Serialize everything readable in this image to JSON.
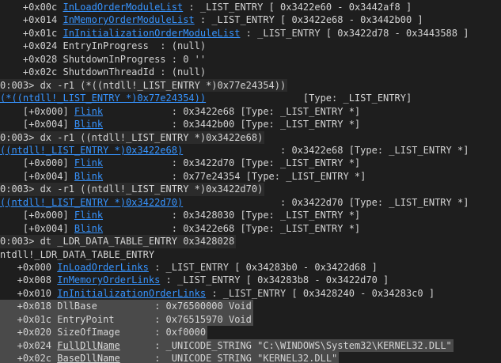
{
  "lines": [
    {
      "cls": "",
      "segs": [
        {
          "t": "    +0x00c "
        },
        {
          "l": "InLoadOrderModuleList"
        },
        {
          "t": " : _LIST_ENTRY [ 0x3422e60 - 0x3442af8 ]"
        }
      ]
    },
    {
      "cls": "",
      "segs": [
        {
          "t": "    +0x014 "
        },
        {
          "l": "InMemoryOrderModuleList"
        },
        {
          "t": " : _LIST_ENTRY [ 0x3422e68 - 0x3442b00 ]"
        }
      ]
    },
    {
      "cls": "",
      "segs": [
        {
          "t": "    +0x01c "
        },
        {
          "l": "InInitializationOrderModuleList"
        },
        {
          "t": " : _LIST_ENTRY [ 0x3422d78 - 0x3443588 ]"
        }
      ]
    },
    {
      "cls": "",
      "segs": [
        {
          "t": "    +0x024 EntryInProgress  : (null)"
        }
      ]
    },
    {
      "cls": "",
      "segs": [
        {
          "t": "    +0x028 ShutdownInProgress : 0 ''"
        }
      ]
    },
    {
      "cls": "",
      "segs": [
        {
          "t": "    +0x02c ShutdownThreadId : (null)"
        }
      ]
    },
    {
      "cls": "hl",
      "segs": [
        {
          "t": "0:003> dx -r1 (*((ntdll!_LIST_ENTRY *)0x77e24354))"
        }
      ]
    },
    {
      "cls": "",
      "segs": [
        {
          "l": "(*((ntdll!_LIST_ENTRY *)0x77e24354))"
        },
        {
          "t": "                 [Type: _LIST_ENTRY]"
        }
      ]
    },
    {
      "cls": "",
      "segs": [
        {
          "t": "    [+0x000] "
        },
        {
          "l": "Flink"
        },
        {
          "t": "            : 0x3422e68 [Type: _LIST_ENTRY *]"
        }
      ]
    },
    {
      "cls": "",
      "segs": [
        {
          "t": "    [+0x004] "
        },
        {
          "l": "Blink"
        },
        {
          "t": "            : 0x3442b00 [Type: _LIST_ENTRY *]"
        }
      ]
    },
    {
      "cls": "hl",
      "segs": [
        {
          "t": "0:003> dx -r1 ((ntdll!_LIST_ENTRY *)0x3422e68)"
        }
      ]
    },
    {
      "cls": "",
      "segs": [
        {
          "l": "((ntdll!_LIST_ENTRY *)0x3422e68)"
        },
        {
          "t": "                 : 0x3422e68 [Type: _LIST_ENTRY *]"
        }
      ]
    },
    {
      "cls": "",
      "segs": [
        {
          "t": "    [+0x000] "
        },
        {
          "l": "Flink"
        },
        {
          "t": "            : 0x3422d70 [Type: _LIST_ENTRY *]"
        }
      ]
    },
    {
      "cls": "",
      "segs": [
        {
          "t": "    [+0x004] "
        },
        {
          "l": "Blink"
        },
        {
          "t": "            : 0x77e24354 [Type: _LIST_ENTRY *]"
        }
      ]
    },
    {
      "cls": "hl",
      "segs": [
        {
          "t": "0:003> dx -r1 ((ntdll!_LIST_ENTRY *)0x3422d70)"
        }
      ]
    },
    {
      "cls": "",
      "segs": [
        {
          "l": "((ntdll!_LIST_ENTRY *)0x3422d70)"
        },
        {
          "t": "                 : 0x3422d70 [Type: _LIST_ENTRY *]"
        }
      ]
    },
    {
      "cls": "",
      "segs": [
        {
          "t": "    [+0x000] "
        },
        {
          "l": "Flink"
        },
        {
          "t": "            : 0x3428030 [Type: _LIST_ENTRY *]"
        }
      ]
    },
    {
      "cls": "",
      "segs": [
        {
          "t": "    [+0x004] "
        },
        {
          "l": "Blink"
        },
        {
          "t": "            : 0x3422e68 [Type: _LIST_ENTRY *]"
        }
      ]
    },
    {
      "cls": "hl",
      "segs": [
        {
          "t": "0:003> dt _LDR_DATA_TABLE_ENTRY 0x3428028"
        }
      ]
    },
    {
      "cls": "",
      "segs": [
        {
          "t": "ntdll!_LDR_DATA_TABLE_ENTRY"
        }
      ]
    },
    {
      "cls": "",
      "segs": [
        {
          "t": "   +0x000 "
        },
        {
          "l": "InLoadOrderLinks"
        },
        {
          "t": " : _LIST_ENTRY [ 0x34283b0 - 0x3422d68 ]"
        }
      ]
    },
    {
      "cls": "",
      "segs": [
        {
          "t": "   +0x008 "
        },
        {
          "l": "InMemoryOrderLinks"
        },
        {
          "t": " : _LIST_ENTRY [ 0x34283b8 - 0x3422d70 ]"
        }
      ]
    },
    {
      "cls": "",
      "segs": [
        {
          "t": "   +0x010 "
        },
        {
          "l": "InInitializationOrderLinks"
        },
        {
          "t": " : _LIST_ENTRY [ 0x3428240 - 0x34283c0 ]"
        }
      ]
    },
    {
      "cls": "sel",
      "segs": [
        {
          "t": "   +0x018 DllBase          : 0x76500000 Void"
        }
      ]
    },
    {
      "cls": "sel",
      "segs": [
        {
          "t": "   +0x01c EntryPoint       : 0x76515970 Void"
        }
      ]
    },
    {
      "cls": "sel",
      "segs": [
        {
          "t": "   +0x020 SizeOfImage      : 0xf0000"
        }
      ]
    },
    {
      "cls": "sel",
      "segs": [
        {
          "t": "   +0x024 "
        },
        {
          "s": "FullDllName"
        },
        {
          "t": "      : _UNICODE_STRING \"C:\\WINDOWS\\System32\\KERNEL32.DLL\""
        }
      ]
    },
    {
      "cls": "sel",
      "segs": [
        {
          "t": "   +0x02c "
        },
        {
          "s": "BaseDllName"
        },
        {
          "t": "      : _UNICODE_STRING \"KERNEL32.DLL\""
        }
      ]
    }
  ]
}
